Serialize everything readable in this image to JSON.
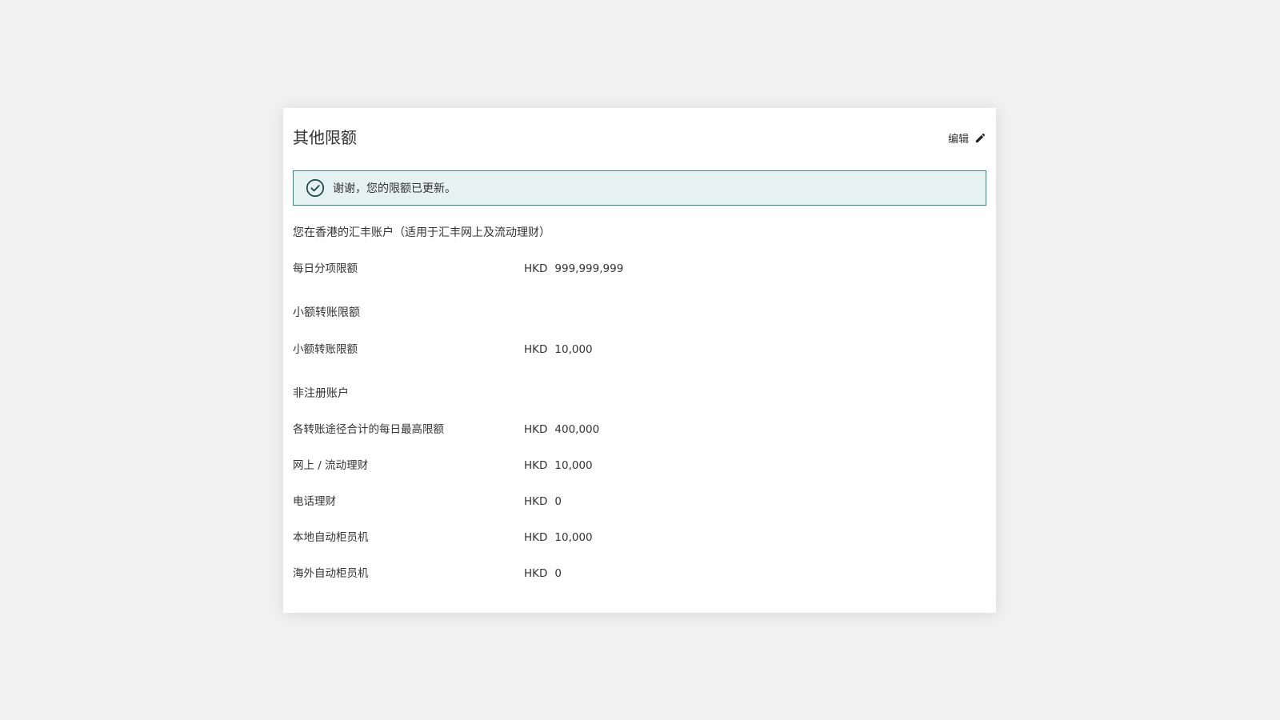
{
  "card": {
    "title": "其他限额",
    "edit_label": "编辑"
  },
  "alert": {
    "message": "谢谢，您的限额已更新。"
  },
  "sections": [
    {
      "heading": "您在香港的汇丰账户（适用于汇丰网上及流动理财）",
      "rows": [
        {
          "label": "每日分项限额",
          "currency": "HKD",
          "amount": "999,999,999"
        }
      ]
    },
    {
      "heading": "小额转账限额",
      "rows": [
        {
          "label": "小额转账限额",
          "currency": "HKD",
          "amount": "10,000"
        }
      ]
    },
    {
      "heading": "非注册账户",
      "rows": [
        {
          "label": "各转账途径合计的每日最高限额",
          "currency": "HKD",
          "amount": "400,000"
        },
        {
          "label": "网上 / 流动理财",
          "currency": "HKD",
          "amount": "10,000"
        },
        {
          "label": "电话理财",
          "currency": "HKD",
          "amount": "0"
        },
        {
          "label": "本地自动柜员机",
          "currency": "HKD",
          "amount": "10,000"
        },
        {
          "label": "海外自动柜员机",
          "currency": "HKD",
          "amount": "0"
        }
      ]
    }
  ],
  "colors": {
    "accent": "#2a8c84",
    "alert_bg": "#e6f2f1",
    "page_bg": "#f1f1f1",
    "text": "#333333"
  },
  "icons": {
    "alert": "check-circle-icon",
    "edit": "pencil-icon"
  }
}
